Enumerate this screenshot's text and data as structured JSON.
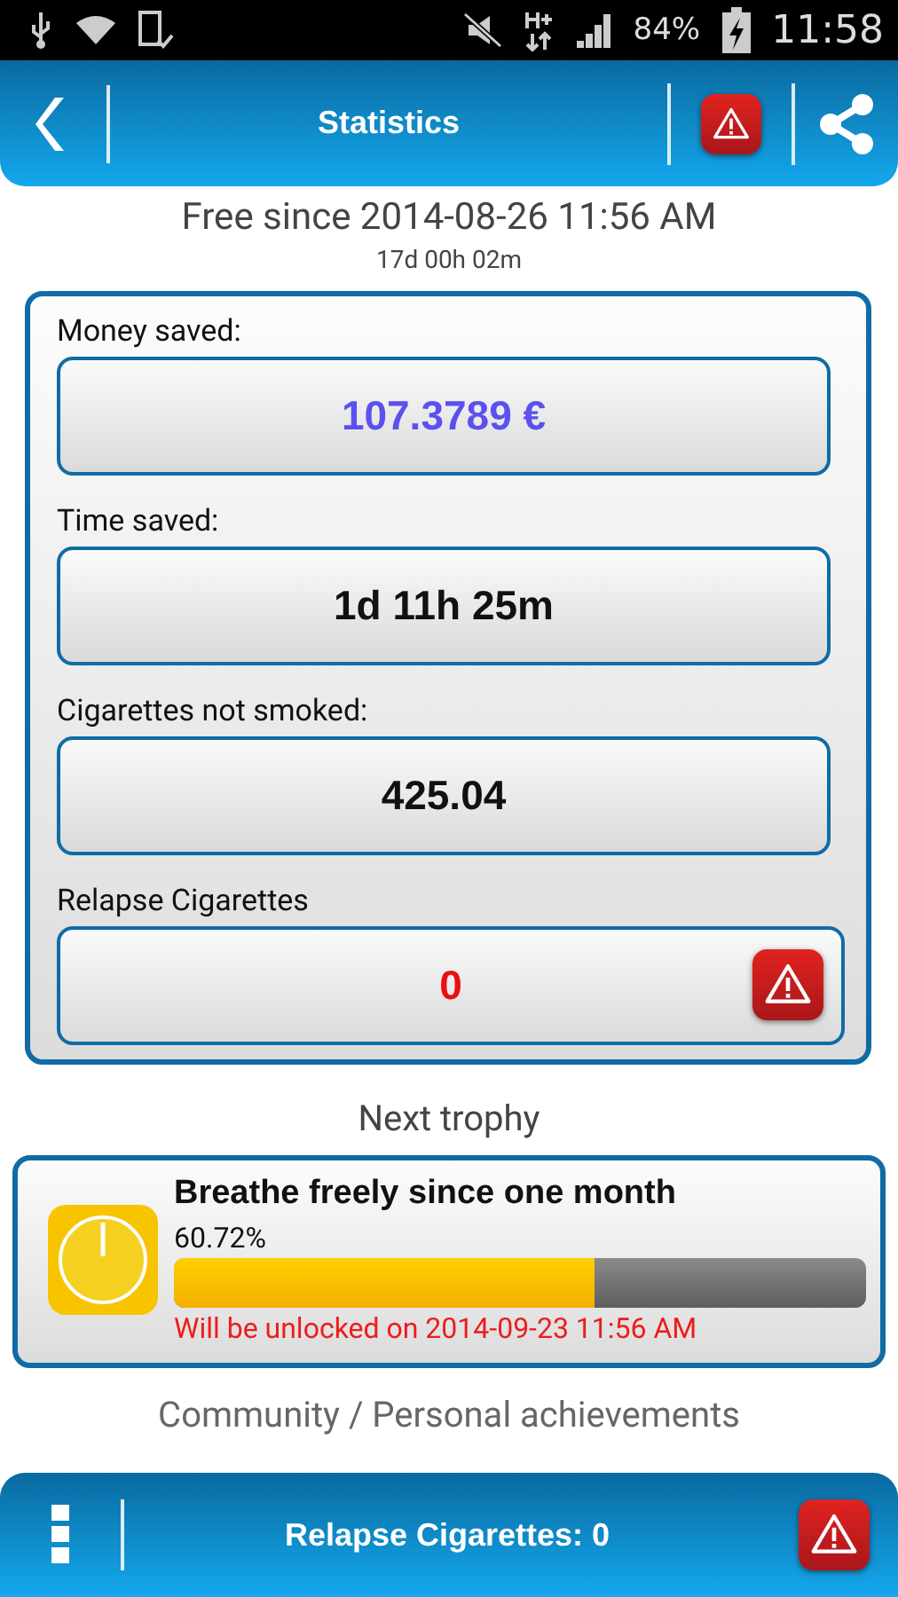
{
  "status_bar": {
    "battery": "84%",
    "time": "11:58"
  },
  "header": {
    "title": "Statistics"
  },
  "free_since": {
    "title": "Free since 2014-08-26 11:56 AM",
    "duration": "17d 00h 02m"
  },
  "stats": [
    {
      "label": "Money saved:",
      "value": "107.3789 €",
      "kind": "money"
    },
    {
      "label": "Time saved:",
      "value": "1d 11h 25m",
      "kind": "plain"
    },
    {
      "label": "Cigarettes not smoked:",
      "value": "425.04",
      "kind": "plain"
    },
    {
      "label": "Relapse Cigarettes",
      "value": "0",
      "kind": "relapse"
    }
  ],
  "next_trophy": {
    "heading": "Next trophy",
    "title": "Breathe freely since one month",
    "percent": "60.72%",
    "level": 0.6072,
    "unlock": "Will be unlocked on 2014-09-23 11:56 AM"
  },
  "community_heading": "Community / Personal achievements",
  "bottom_bar": {
    "label": "Relapse Cigarettes: 0"
  }
}
